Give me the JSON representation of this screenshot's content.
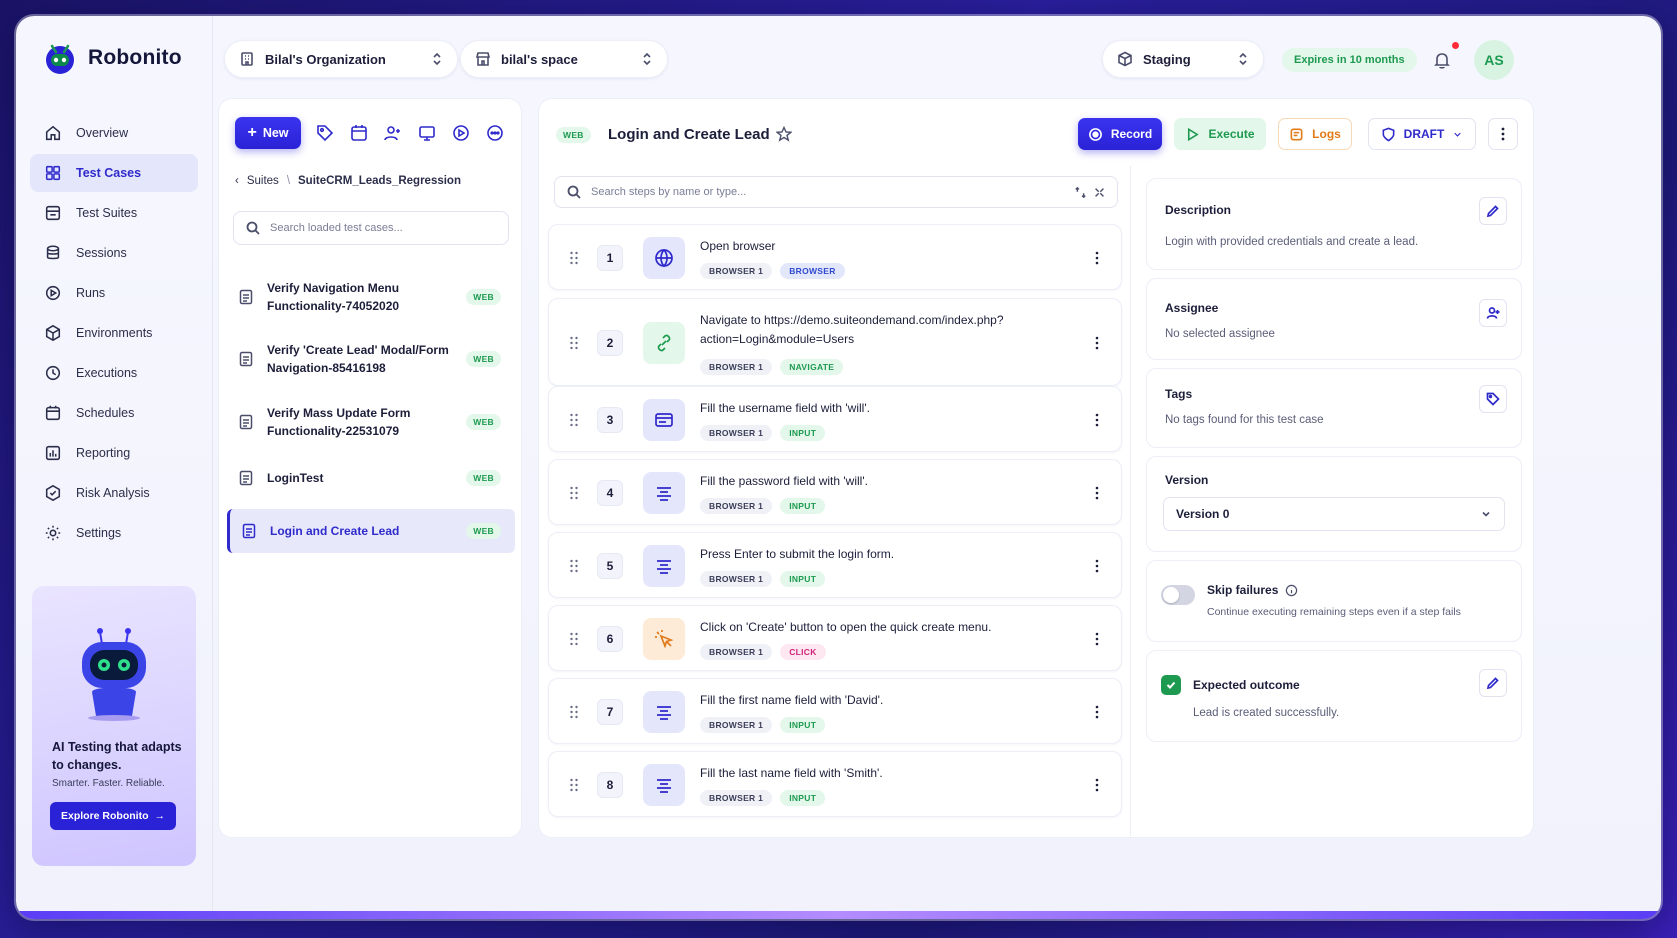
{
  "app": {
    "name": "Robonito"
  },
  "topbar": {
    "organization": "Bilal's Organization",
    "space": "bilal's space",
    "environment": "Staging",
    "expires": "Expires in 10 months",
    "avatar_initials": "AS"
  },
  "sidebar": {
    "items": [
      {
        "label": "Overview",
        "icon": "home-icon"
      },
      {
        "label": "Test Cases",
        "icon": "grid-icon",
        "active": true
      },
      {
        "label": "Test Suites",
        "icon": "suite-icon"
      },
      {
        "label": "Sessions",
        "icon": "database-icon"
      },
      {
        "label": "Runs",
        "icon": "runs-icon"
      },
      {
        "label": "Environments",
        "icon": "cube-icon"
      },
      {
        "label": "Executions",
        "icon": "executions-icon"
      },
      {
        "label": "Schedules",
        "icon": "calendar-icon"
      },
      {
        "label": "Reporting",
        "icon": "reporting-icon"
      },
      {
        "label": "Risk Analysis",
        "icon": "risk-icon"
      },
      {
        "label": "Settings",
        "icon": "gear-icon"
      }
    ],
    "promo": {
      "title": "AI Testing that adapts to changes.",
      "subtitle": "Smarter. Faster. Reliable.",
      "button": "Explore Robonito"
    }
  },
  "testlist": {
    "new_label": "New",
    "breadcrumb_root": "Suites",
    "breadcrumb_sep": "\\",
    "breadcrumb_current": "SuiteCRM_Leads_Regression",
    "search_placeholder": "Search loaded test cases...",
    "items": [
      {
        "title": "Verify Navigation Menu Functionality-74052020",
        "tag": "WEB"
      },
      {
        "title": "Verify 'Create Lead' Modal/Form Navigation-85416198",
        "tag": "WEB"
      },
      {
        "title": "Verify Mass Update Form Functionality-22531079",
        "tag": "WEB"
      },
      {
        "title": "LoginTest",
        "tag": "WEB"
      },
      {
        "title": "Login and Create Lead",
        "tag": "WEB",
        "active": true
      }
    ]
  },
  "detail": {
    "tag": "WEB",
    "title": "Login and Create Lead",
    "record": "Record",
    "execute": "Execute",
    "logs": "Logs",
    "status": "DRAFT",
    "search_placeholder": "Search steps by name or type...",
    "steps": [
      {
        "num": "1",
        "text": "Open browser",
        "browser": "BROWSER 1",
        "type": "BROWSER",
        "icon": "globe-icon"
      },
      {
        "num": "2",
        "text": "Navigate to https://demo.suiteondemand.com/index.php?action=Login&module=Users",
        "browser": "BROWSER 1",
        "type": "NAVIGATE",
        "icon": "link-icon"
      },
      {
        "num": "3",
        "text": "Fill the username field with 'will'.",
        "browser": "BROWSER 1",
        "type": "INPUT",
        "icon": "form-icon"
      },
      {
        "num": "4",
        "text": "Fill the password field with 'will'.",
        "browser": "BROWSER 1",
        "type": "INPUT",
        "icon": "text-lines-icon"
      },
      {
        "num": "5",
        "text": "Press Enter to submit the login form.",
        "browser": "BROWSER 1",
        "type": "INPUT",
        "icon": "text-lines-icon"
      },
      {
        "num": "6",
        "text": "Click on 'Create' button to open the quick create menu.",
        "browser": "BROWSER 1",
        "type": "CLICK",
        "icon": "cursor-click-icon"
      },
      {
        "num": "7",
        "text": "Fill the first name field with 'David'.",
        "browser": "BROWSER 1",
        "type": "INPUT",
        "icon": "text-lines-icon"
      },
      {
        "num": "8",
        "text": "Fill the last name field with 'Smith'.",
        "browser": "BROWSER 1",
        "type": "INPUT",
        "icon": "text-lines-icon"
      }
    ]
  },
  "info": {
    "description_title": "Description",
    "description": "Login with provided credentials and create a lead.",
    "assignee_title": "Assignee",
    "assignee": "No selected assignee",
    "tags_title": "Tags",
    "tags": "No tags found for this test case",
    "version_title": "Version",
    "version": "Version 0",
    "skip_title": "Skip failures",
    "skip_desc": "Continue executing remaining steps even if a step fails",
    "outcome_title": "Expected outcome",
    "outcome": "Lead is created successfully."
  },
  "colors": {
    "accent": "#2a22d6",
    "green": "#1d9a50",
    "background": "#f3f4fc"
  }
}
